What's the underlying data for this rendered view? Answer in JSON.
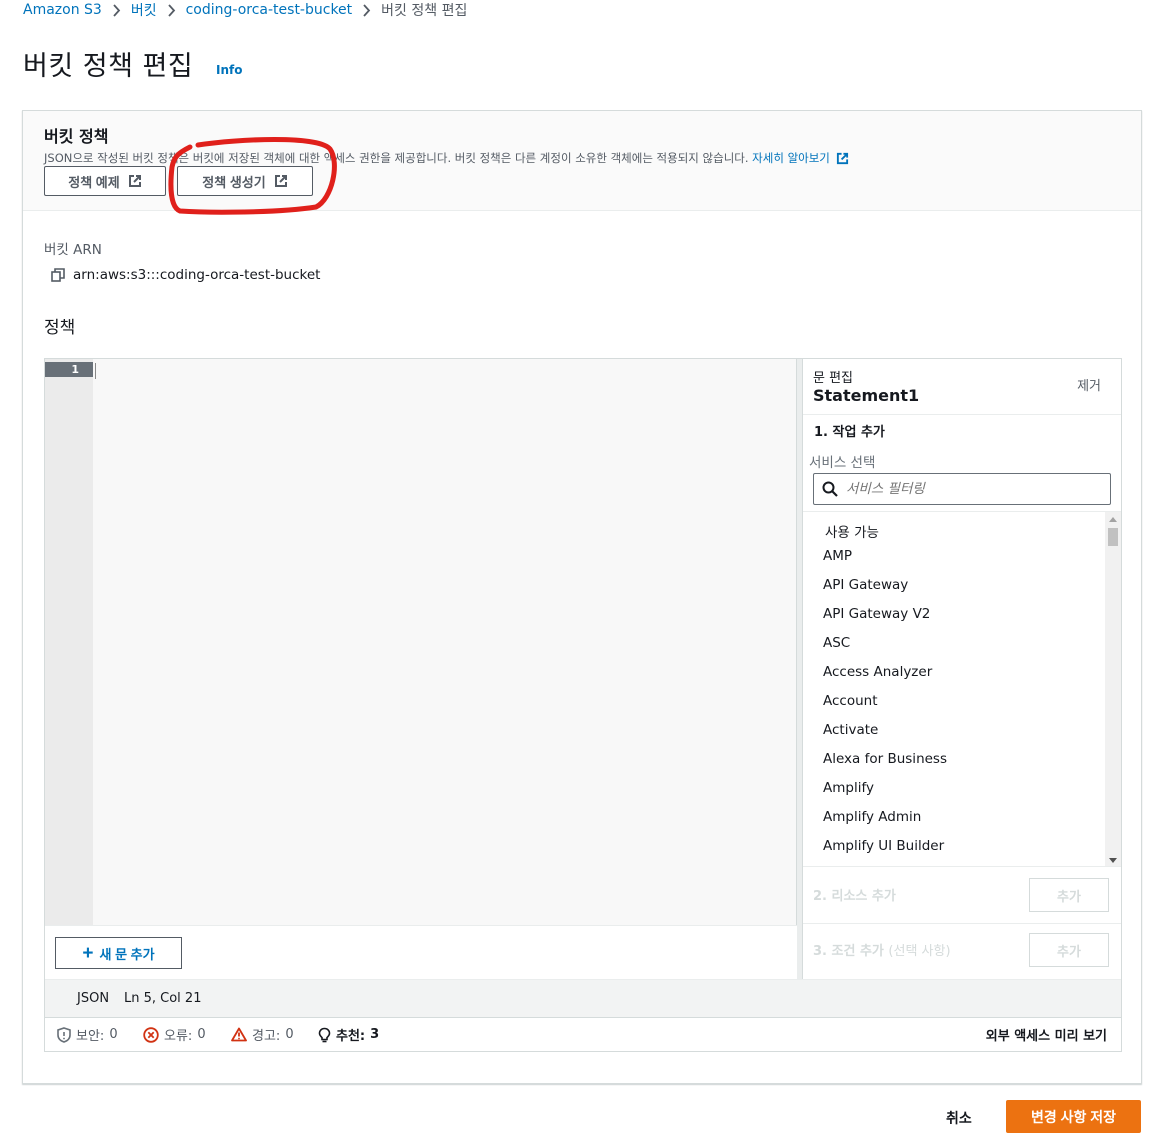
{
  "breadcrumb": {
    "items": [
      "Amazon S3",
      "버킷",
      "coding-orca-test-bucket",
      "버킷 정책 편집"
    ]
  },
  "page": {
    "title": "버킷 정책 편집",
    "info": "Info"
  },
  "panel": {
    "title": "버킷 정책",
    "description": "JSON으로 작성된 버킷 정책은 버킷에 저장된 객체에 대한 액세스 권한을 제공합니다. 버킷 정책은 다른 계정이 소유한 객체에는 적용되지 않습니다.",
    "learn_more": "자세히 알아보기",
    "btn_policy_example": "정책 예제",
    "btn_policy_generator": "정책 생성기",
    "annotation_color": "#e0201b"
  },
  "arn": {
    "label": "버킷 ARN",
    "value": "arn:aws:s3:::coding-orca-test-bucket"
  },
  "policy": {
    "label": "정책",
    "line_number": "1",
    "add_statement": "새 문 추가"
  },
  "side_panel": {
    "sub_title": "문 편집",
    "title": "Statement1",
    "remove": "제거",
    "step1": "1. 작업 추가",
    "service_label": "서비스 선택",
    "search_placeholder": "서비스 필터링",
    "list_heading": "사용 가능",
    "services": [
      "AMP",
      "API Gateway",
      "API Gateway V2",
      "ASC",
      "Access Analyzer",
      "Account",
      "Activate",
      "Alexa for Business",
      "Amplify",
      "Amplify Admin",
      "Amplify UI Builder"
    ],
    "step2": "2. 리소스 추가",
    "step3": "3. 조건 추가",
    "step3_optional": "(선택 사항)",
    "add_btn": "추가"
  },
  "status": {
    "language": "JSON",
    "position": "Ln 5, Col 21"
  },
  "validation": {
    "security_label": "보안:",
    "security_count": "0",
    "errors_label": "오류:",
    "errors_count": "0",
    "warnings_label": "경고:",
    "warnings_count": "0",
    "suggestions_label": "추천:",
    "suggestions_count": "3",
    "preview_external": "외부 액세스 미리 보기"
  },
  "footer": {
    "cancel": "취소",
    "save": "변경 사항 저장"
  },
  "colors": {
    "link": "#0073bb",
    "primary": "#ec7211",
    "error": "#d13212",
    "warning": "#d13212"
  }
}
